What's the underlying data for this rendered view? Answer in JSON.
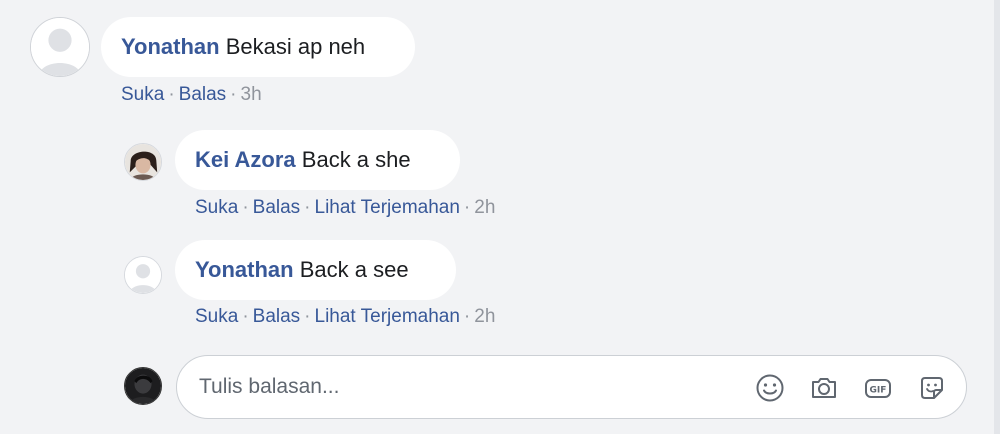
{
  "comments": [
    {
      "author": "Yonathan",
      "text": "Bekasi ap neh",
      "like": "Suka",
      "reply": "Balas",
      "time": "3h"
    },
    {
      "author": "Kei Azora",
      "text": "Back a she",
      "like": "Suka",
      "reply": "Balas",
      "translate": "Lihat Terjemahan",
      "time": "2h"
    },
    {
      "author": "Yonathan",
      "text": "Back a see",
      "like": "Suka",
      "reply": "Balas",
      "translate": "Lihat Terjemahan",
      "time": "2h"
    }
  ],
  "reply_box": {
    "placeholder": "Tulis balasan...",
    "icons": [
      "emoji-icon",
      "camera-icon",
      "gif-icon",
      "sticker-icon"
    ]
  },
  "colors": {
    "link": "#385898",
    "meta": "#90949c",
    "background": "#f2f3f5"
  }
}
